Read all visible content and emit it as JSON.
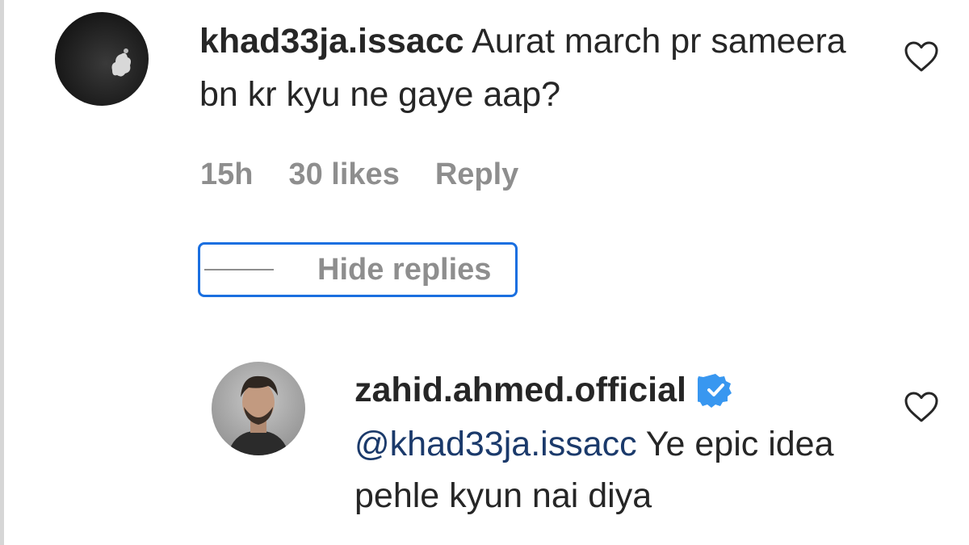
{
  "comment": {
    "username": "khad33ja.issacc",
    "text": "Aurat march pr sameera bn kr kyu ne gaye aap?",
    "time": "15h",
    "likes": "30 likes",
    "reply_label": "Reply",
    "avatar_icon": "user-avatar-dark",
    "like_icon": "heart-outline-icon"
  },
  "hide_replies_label": "Hide replies",
  "reply": {
    "username": "zahid.ahmed.official",
    "verified_icon": "verified-badge-icon",
    "mention": "@khad33ja.issacc",
    "text": " Ye epic idea pehle kyun nai diya",
    "avatar_icon": "user-avatar-photo",
    "like_icon": "heart-outline-icon"
  },
  "colors": {
    "text": "#262626",
    "secondary": "#8e8e8e",
    "focus_outline": "#1a6fe0",
    "mention": "#1b3a6b",
    "verified": "#3897f0"
  }
}
